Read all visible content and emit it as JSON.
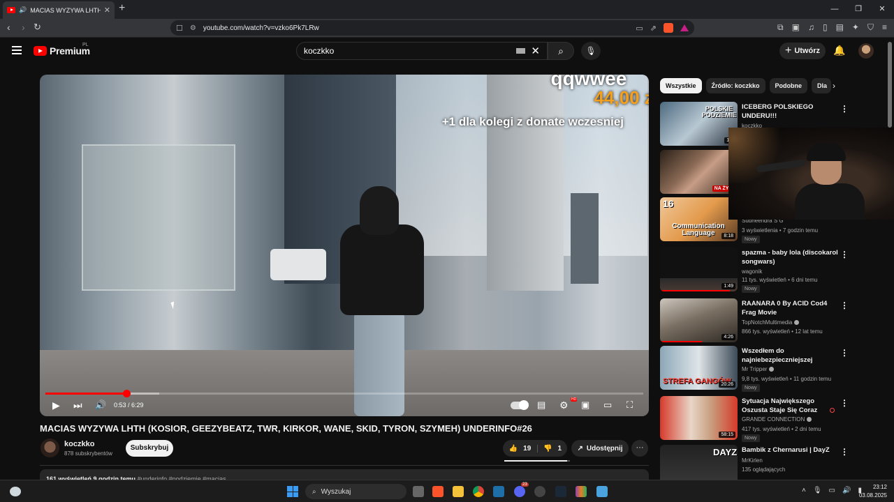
{
  "browser": {
    "tab_title": "MACIAS WYZYWA LHTH (KOS",
    "tab_close": "✕",
    "new_tab": "+",
    "url": "youtube.com/watch?v=vzko6Pk7LRw",
    "window_controls": [
      "—",
      "❐",
      "✕"
    ]
  },
  "header": {
    "logo_text": "Premium",
    "logo_region": "PL",
    "search_value": "koczkko",
    "create_label": "Utwórz"
  },
  "player": {
    "overlay_name": "qqwwee",
    "overlay_amount": "44,00 zł",
    "overlay_message": "+1 dla kolegi z donate wczesniej",
    "time_current": "0:53",
    "time_total": "6:29",
    "time_display": "0:53 / 6:29",
    "progress_fraction": 0.136,
    "buffered_fraction": 0.19,
    "hd_badge": "HD"
  },
  "video": {
    "title": "MACIAS WYZYWA LHTH (KOSIOR, GEEZYBEATZ, TWR, KIRKOR, WANE, SKID, TYRON, SZYMEH) UNDERINFO#26",
    "channel": "koczkko",
    "subscribers": "878 subskrybentów",
    "subscribe_label": "Subskrybuj",
    "likes": "19",
    "dislikes": "1",
    "share_label": "Udostępnij",
    "more_label": "···",
    "desc_stats": "161 wyświetleń  9 godzin temu",
    "desc_tags": "#underinfo #podziemie #macias"
  },
  "sidebar": {
    "chips": [
      "Wszystkie",
      "Źródło: koczkko",
      "Podobne",
      "Dla"
    ],
    "recommendations": [
      {
        "title": "ICEBERG POLSKIEGO UNDERU!!!",
        "channel": "koczkko",
        "meta": "",
        "duration": "14:",
        "badge": "",
        "thumb_text": "POLSKIE PODZIEMIE"
      },
      {
        "title": "",
        "channel": "",
        "meta": "",
        "duration": "",
        "live": "NA ŻYW",
        "badge": "",
        "thumb_text": ""
      },
      {
        "title": "",
        "channel": "Sudheendra S G",
        "meta": "3 wyświetlenia • 7 godzin temu",
        "duration": "8:18",
        "badge": "Nowy",
        "thumb_text": "Communication Language",
        "thumb_num": "16"
      },
      {
        "title": "spazma - baby lola (discokarol songwars)",
        "channel": "wagonik",
        "meta": "11 tys. wyświetleń • 6 dni temu",
        "duration": "1:49",
        "badge": "Nowy",
        "thumb_text": ""
      },
      {
        "title": "RAANARA 0 By ACID Cod4 Frag Movie",
        "channel": "TopNotchMultimedia",
        "meta": "866 tys. wyświetleń • 12 lat temu",
        "duration": "4:26",
        "badge": "",
        "thumb_text": ""
      },
      {
        "title": "Wszedłem do najniebezpieczniejszej dzielni...",
        "channel": "Mr Tripper",
        "meta": "9,8 tys. wyświetleń • 11 godzin temu",
        "duration": "20:26",
        "badge": "Nowy",
        "thumb_text": "STREFA GANGÓW"
      },
      {
        "title": "Sytuacja Największego Oszusta Staje Się Coraz GORSZA...",
        "channel": "GRANDE CONNECTION",
        "meta": "417 tys. wyświetleń • 2 dni temu",
        "duration": "58:15",
        "badge": "Nowy",
        "thumb_text": ""
      },
      {
        "title": "Bambik z Chernarusi | DayZ",
        "channel": "MrKirlen",
        "meta": "135 oglądających",
        "duration": "",
        "badge": "",
        "thumb_text": "DAYZ"
      }
    ]
  },
  "taskbar": {
    "search_label": "Wyszukaj",
    "time": "23:12",
    "date": "03.08.2025",
    "discord_badge": "23"
  },
  "colors": {
    "yt_red": "#ff0000",
    "bg": "#0f0f0f",
    "chip_bg": "#272727",
    "donate_amount": "#f4a01c"
  }
}
